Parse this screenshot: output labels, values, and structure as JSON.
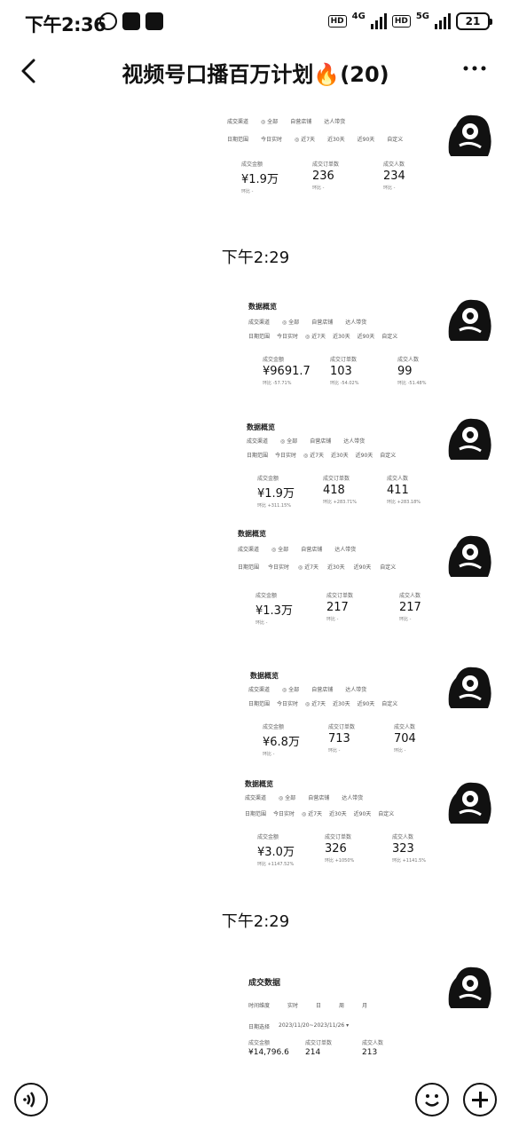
{
  "status_bar": {
    "time": "下午2:36",
    "network_1": "4G",
    "network_2": "5G",
    "hd": "HD",
    "battery": "21"
  },
  "nav": {
    "title": "视频号口播百万计划🔥(20)"
  },
  "chat": {
    "timestamps": [
      "下午2:29",
      "下午2:29"
    ],
    "messages": [
      {
        "title": "",
        "filter_row_1": [
          "成交渠道",
          "全部",
          "自营店铺",
          "达人带货"
        ],
        "filter_row_2": [
          "日期范围",
          "今日实时",
          "近7天",
          "近30天",
          "近90天",
          "自定义"
        ],
        "stats": [
          {
            "label": "成交金额",
            "value": "¥1.9万",
            "sub": "环比 -"
          },
          {
            "label": "成交订单数",
            "value": "236",
            "sub": "环比 -"
          },
          {
            "label": "成交人数",
            "value": "234",
            "sub": "环比 -"
          }
        ]
      },
      {
        "title": "数据概览",
        "filter_row_1": [
          "成交渠道",
          "全部",
          "自营店铺",
          "达人带货"
        ],
        "filter_row_2": [
          "日期范围",
          "今日实时",
          "近7天",
          "近30天",
          "近90天",
          "自定义"
        ],
        "stats": [
          {
            "label": "成交金额",
            "value": "¥9691.7",
            "sub": "环比 -57.71%"
          },
          {
            "label": "成交订单数",
            "value": "103",
            "sub": "环比 -54.02%"
          },
          {
            "label": "成交人数",
            "value": "99",
            "sub": "环比 -51.48%"
          }
        ]
      },
      {
        "title": "数据概览",
        "filter_row_1": [
          "成交渠道",
          "全部",
          "自营店铺",
          "达人带货"
        ],
        "filter_row_2": [
          "日期范围",
          "今日实时",
          "近7天",
          "近30天",
          "近90天",
          "自定义"
        ],
        "stats": [
          {
            "label": "成交金额",
            "value": "¥1.9万",
            "sub": "环比 +311.15%"
          },
          {
            "label": "成交订单数",
            "value": "418",
            "sub": "环比 +283.71%"
          },
          {
            "label": "成交人数",
            "value": "411",
            "sub": "环比 +283.18%"
          }
        ]
      },
      {
        "title": "数据概览",
        "filter_row_1": [
          "成交渠道",
          "全部",
          "自营店铺",
          "达人带货"
        ],
        "filter_row_2": [
          "日期范围",
          "今日实时",
          "近7天",
          "近30天",
          "近90天",
          "自定义"
        ],
        "stats": [
          {
            "label": "成交金额",
            "value": "¥1.3万",
            "sub": "环比 -"
          },
          {
            "label": "成交订单数",
            "value": "217",
            "sub": "环比 -"
          },
          {
            "label": "成交人数",
            "value": "217",
            "sub": "环比 -"
          }
        ]
      },
      {
        "title": "数据概览",
        "filter_row_1": [
          "成交渠道",
          "全部",
          "自营店铺",
          "达人带货"
        ],
        "filter_row_2": [
          "日期范围",
          "今日实时",
          "近7天",
          "近30天",
          "近90天",
          "自定义"
        ],
        "stats": [
          {
            "label": "成交金额",
            "value": "¥6.8万",
            "sub": "环比 -"
          },
          {
            "label": "成交订单数",
            "value": "713",
            "sub": "环比 -"
          },
          {
            "label": "成交人数",
            "value": "704",
            "sub": "环比 -"
          }
        ]
      },
      {
        "title": "数据概览",
        "filter_row_1": [
          "成交渠道",
          "全部",
          "自营店铺",
          "达人带货"
        ],
        "filter_row_2": [
          "日期范围",
          "今日实时",
          "近7天",
          "近30天",
          "近90天",
          "自定义"
        ],
        "stats": [
          {
            "label": "成交金额",
            "value": "¥3.0万",
            "sub": "环比 +1147.52%"
          },
          {
            "label": "成交订单数",
            "value": "326",
            "sub": "环比 +1050%"
          },
          {
            "label": "成交人数",
            "value": "323",
            "sub": "环比 +1141.5%"
          }
        ]
      },
      {
        "title": "成交数据",
        "filter_row_1": [
          "时间维度",
          "实时",
          "日",
          "周",
          "月"
        ],
        "filter_row_2": [
          "日期选择",
          "2023/11/20~2023/11/26 ▾"
        ],
        "stats": [
          {
            "label": "成交金额",
            "value": "¥14,796.6",
            "sub": ""
          },
          {
            "label": "成交订单数",
            "value": "214",
            "sub": ""
          },
          {
            "label": "成交人数",
            "value": "213",
            "sub": ""
          }
        ]
      }
    ]
  },
  "bottom_bar": {
    "voice_icon": "voice-icon",
    "emoji_icon": "emoji-icon",
    "plus_icon": "plus-icon"
  }
}
